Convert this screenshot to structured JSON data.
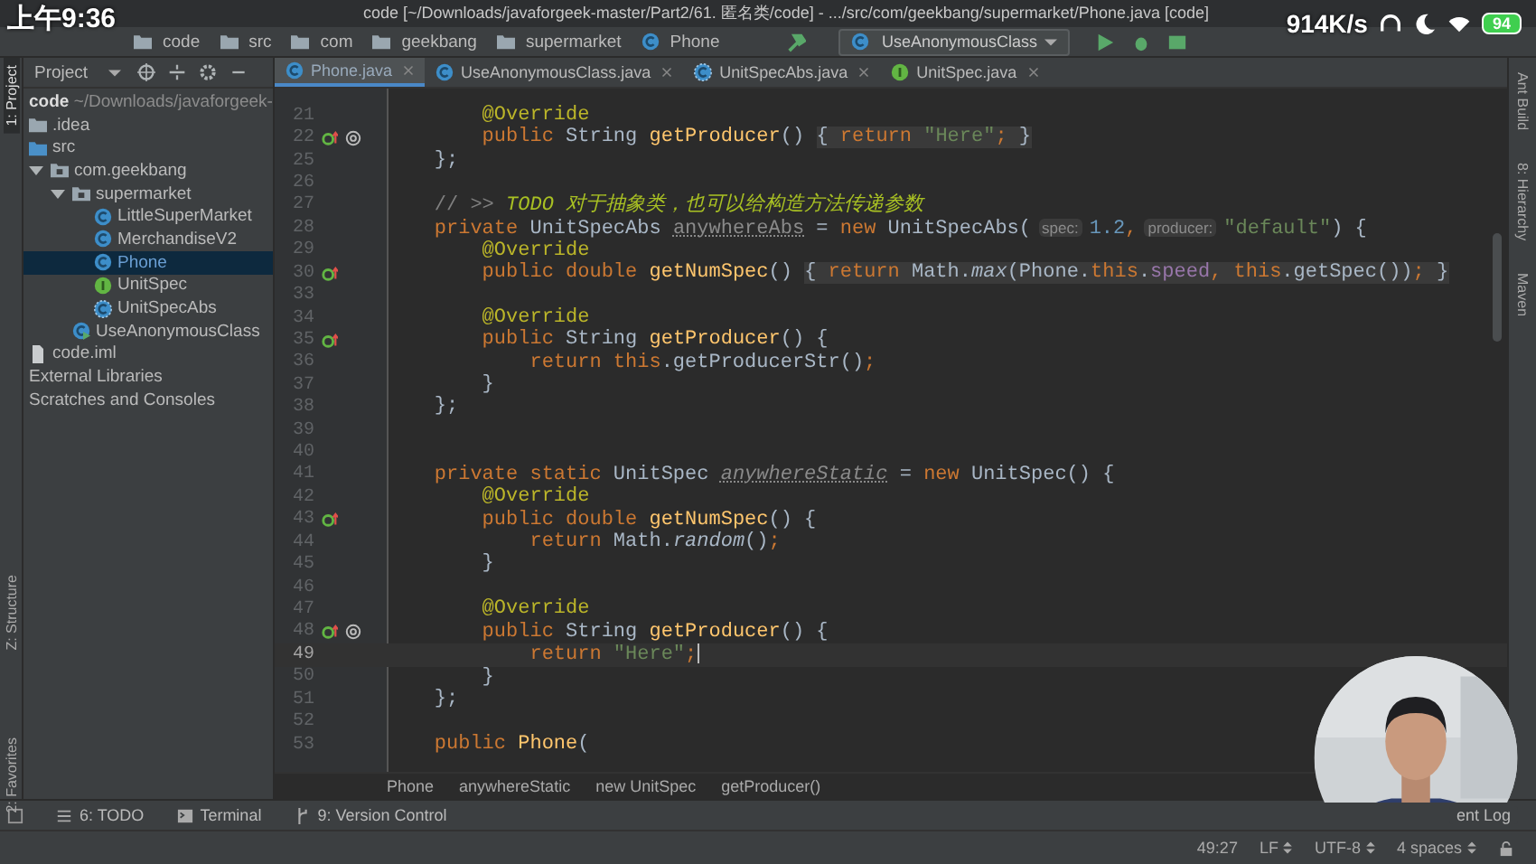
{
  "overlay": {
    "time": "上午9:36",
    "speed": "914K/s",
    "battery": "94"
  },
  "window": {
    "title": "code [~/Downloads/javaforgeek-master/Part2/61. 匿名类/code] - .../src/com/geekbang/supermarket/Phone.java [code]"
  },
  "nav_bar": {
    "crumbs": [
      {
        "label": "code",
        "kind": "folder"
      },
      {
        "label": "src",
        "kind": "folder"
      },
      {
        "label": "com",
        "kind": "folder"
      },
      {
        "label": "geekbang",
        "kind": "folder"
      },
      {
        "label": "supermarket",
        "kind": "folder"
      },
      {
        "label": "Phone",
        "kind": "class"
      }
    ],
    "run_config": "UseAnonymousClass"
  },
  "left_strip": [
    {
      "label": "1: Project",
      "selected": true
    },
    {
      "label": "Z: Structure",
      "selected": false
    },
    {
      "label": "2: Favorites",
      "selected": false
    }
  ],
  "right_strip": [
    {
      "label": "Ant Build"
    },
    {
      "label": "8: Hierarchy"
    },
    {
      "label": "Maven"
    }
  ],
  "project_panel": {
    "title": "Project",
    "root": {
      "label": "code",
      "path": "~/Downloads/javaforgeek-"
    },
    "tree": [
      {
        "label": ".idea",
        "kind": "folder",
        "selected": false
      },
      {
        "label": "src",
        "kind": "source_folder",
        "selected": false
      },
      {
        "label": "com.geekbang",
        "kind": "package",
        "selected": false,
        "expanded": true,
        "children": [
          {
            "label": "supermarket",
            "kind": "package",
            "selected": false,
            "expanded": true,
            "children": [
              {
                "label": "LittleSuperMarket",
                "kind": "class",
                "selected": false
              },
              {
                "label": "MerchandiseV2",
                "kind": "class",
                "selected": false
              },
              {
                "label": "Phone",
                "kind": "class",
                "selected": true
              },
              {
                "label": "UnitSpec",
                "kind": "interface",
                "selected": false
              },
              {
                "label": "UnitSpecAbs",
                "kind": "abstract_class",
                "selected": false
              }
            ]
          },
          {
            "label": "UseAnonymousClass",
            "kind": "runnable_class",
            "selected": false
          }
        ]
      },
      {
        "label": "code.iml",
        "kind": "file",
        "selected": false
      },
      {
        "label": "External Libraries",
        "kind": "plain",
        "selected": false
      },
      {
        "label": "Scratches and Consoles",
        "kind": "plain",
        "selected": false
      }
    ]
  },
  "tabs": [
    {
      "label": "Phone.java",
      "kind": "class",
      "selected": true
    },
    {
      "label": "UseAnonymousClass.java",
      "kind": "class",
      "selected": false
    },
    {
      "label": "UnitSpecAbs.java",
      "kind": "abstract_class",
      "selected": false
    },
    {
      "label": "UnitSpec.java",
      "kind": "interface",
      "selected": false
    }
  ],
  "lines": [
    {
      "number": "21",
      "current": false,
      "tokens": [
        {
          "kind": "annotation",
          "text": "        @Override"
        }
      ]
    },
    {
      "number": "22",
      "current": false,
      "gutter": [
        {
          "kind": "override"
        },
        {
          "kind": "at"
        }
      ],
      "tokens": [
        {
          "kind": "keyword",
          "text": "        public "
        },
        {
          "kind": "plain",
          "text": "String "
        },
        {
          "kind": "method",
          "text": "getProducer"
        },
        {
          "kind": "plain",
          "text": "() "
        }
      ],
      "folded": [
        {
          "kind": "plain",
          "text": "{ "
        },
        {
          "kind": "keyword",
          "text": "return "
        },
        {
          "kind": "string",
          "text": "\"Here\""
        },
        {
          "kind": "keyword",
          "text": ";"
        },
        {
          "kind": "plain",
          "text": " }"
        }
      ]
    },
    {
      "number": "25",
      "current": false,
      "tokens": [
        {
          "kind": "plain",
          "text": "    };"
        }
      ]
    },
    {
      "number": "26",
      "current": false
    },
    {
      "number": "27",
      "current": false,
      "tokens": [
        {
          "kind": "comment",
          "text": "    // >> "
        },
        {
          "kind": "todo",
          "text": "TODO 对于抽象类，也可以给构造方法传递参数"
        }
      ]
    },
    {
      "number": "28",
      "current": false,
      "tokens": [
        {
          "kind": "keyword",
          "text": "    private "
        },
        {
          "kind": "plain",
          "text": "UnitSpecAbs "
        },
        {
          "kind": "unused",
          "text": "anywhereAbs"
        },
        {
          "kind": "plain",
          "text": " = "
        },
        {
          "kind": "keyword",
          "text": "new "
        },
        {
          "kind": "plain",
          "text": "UnitSpecAbs("
        },
        {
          "kind": "hint",
          "text": "spec:"
        },
        {
          "kind": "number",
          "text": "1.2"
        },
        {
          "kind": "keyword",
          "text": ","
        },
        {
          "kind": "hint",
          "text": "producer:"
        },
        {
          "kind": "string",
          "text": "\"default\""
        },
        {
          "kind": "plain",
          "text": ") {"
        }
      ]
    },
    {
      "number": "29",
      "current": false,
      "tokens": [
        {
          "kind": "annotation",
          "text": "        @Override"
        }
      ]
    },
    {
      "number": "30",
      "current": false,
      "gutter": [
        {
          "kind": "override"
        }
      ],
      "tokens": [
        {
          "kind": "keyword",
          "text": "        public double "
        },
        {
          "kind": "method",
          "text": "getNumSpec"
        },
        {
          "kind": "plain",
          "text": "() "
        }
      ],
      "folded": [
        {
          "kind": "plain",
          "text": "{ "
        },
        {
          "kind": "keyword",
          "text": "return "
        },
        {
          "kind": "plain",
          "text": "Math."
        },
        {
          "kind": "static_call",
          "text": "max"
        },
        {
          "kind": "plain",
          "text": "(Phone."
        },
        {
          "kind": "keyword",
          "text": "this"
        },
        {
          "kind": "plain",
          "text": "."
        },
        {
          "kind": "field",
          "text": "speed"
        },
        {
          "kind": "keyword",
          "text": ", this"
        },
        {
          "kind": "plain",
          "text": ".getSpec())"
        },
        {
          "kind": "keyword",
          "text": ";"
        },
        {
          "kind": "plain",
          "text": " }"
        }
      ]
    },
    {
      "number": "33",
      "current": false
    },
    {
      "number": "34",
      "current": false,
      "tokens": [
        {
          "kind": "annotation",
          "text": "        @Override"
        }
      ]
    },
    {
      "number": "35",
      "current": false,
      "gutter": [
        {
          "kind": "override"
        }
      ],
      "tokens": [
        {
          "kind": "keyword",
          "text": "        public "
        },
        {
          "kind": "plain",
          "text": "String "
        },
        {
          "kind": "method",
          "text": "getProducer"
        },
        {
          "kind": "plain",
          "text": "() {"
        }
      ]
    },
    {
      "number": "36",
      "current": false,
      "tokens": [
        {
          "kind": "keyword",
          "text": "            return this"
        },
        {
          "kind": "plain",
          "text": ".getProducerStr()"
        },
        {
          "kind": "keyword",
          "text": ";"
        }
      ]
    },
    {
      "number": "37",
      "current": false,
      "tokens": [
        {
          "kind": "plain",
          "text": "        }"
        }
      ]
    },
    {
      "number": "38",
      "current": false,
      "tokens": [
        {
          "kind": "plain",
          "text": "    };"
        }
      ]
    },
    {
      "number": "39",
      "current": false
    },
    {
      "number": "40",
      "current": false
    },
    {
      "number": "41",
      "current": false,
      "tokens": [
        {
          "kind": "keyword",
          "text": "    private static "
        },
        {
          "kind": "plain",
          "text": "UnitSpec "
        },
        {
          "kind": "unused_static",
          "text": "anywhereStatic"
        },
        {
          "kind": "plain",
          "text": " = "
        },
        {
          "kind": "keyword",
          "text": "new "
        },
        {
          "kind": "plain",
          "text": "UnitSpec() {"
        }
      ]
    },
    {
      "number": "42",
      "current": false,
      "tokens": [
        {
          "kind": "annotation",
          "text": "        @Override"
        }
      ]
    },
    {
      "number": "43",
      "current": false,
      "gutter": [
        {
          "kind": "override"
        }
      ],
      "tokens": [
        {
          "kind": "keyword",
          "text": "        public double "
        },
        {
          "kind": "method",
          "text": "getNumSpec"
        },
        {
          "kind": "plain",
          "text": "() {"
        }
      ]
    },
    {
      "number": "44",
      "current": false,
      "tokens": [
        {
          "kind": "keyword",
          "text": "            return "
        },
        {
          "kind": "plain",
          "text": "Math."
        },
        {
          "kind": "static_call",
          "text": "random"
        },
        {
          "kind": "plain",
          "text": "()"
        },
        {
          "kind": "keyword",
          "text": ";"
        }
      ]
    },
    {
      "number": "45",
      "current": false,
      "tokens": [
        {
          "kind": "plain",
          "text": "        }"
        }
      ]
    },
    {
      "number": "46",
      "current": false
    },
    {
      "number": "47",
      "current": false,
      "tokens": [
        {
          "kind": "annotation",
          "text": "        @Override"
        }
      ]
    },
    {
      "number": "48",
      "current": false,
      "gutter": [
        {
          "kind": "override"
        },
        {
          "kind": "at"
        }
      ],
      "tokens": [
        {
          "kind": "keyword",
          "text": "        public "
        },
        {
          "kind": "plain",
          "text": "String "
        },
        {
          "kind": "method",
          "text": "getProducer"
        },
        {
          "kind": "plain",
          "text": "() {"
        }
      ]
    },
    {
      "number": "49",
      "current": true,
      "tokens": [
        {
          "kind": "keyword",
          "text": "            return "
        },
        {
          "kind": "string",
          "text": "\"Here\""
        },
        {
          "kind": "keyword",
          "text": ";"
        }
      ]
    },
    {
      "number": "50",
      "current": false,
      "tokens": [
        {
          "kind": "plain",
          "text": "        }"
        }
      ]
    },
    {
      "number": "51",
      "current": false,
      "tokens": [
        {
          "kind": "plain",
          "text": "    };"
        }
      ]
    },
    {
      "number": "52",
      "current": false
    },
    {
      "number": "53",
      "current": false,
      "tokens": [
        {
          "kind": "keyword",
          "text": "    public "
        },
        {
          "kind": "method",
          "text": "Phone"
        },
        {
          "kind": "plain",
          "text": "("
        }
      ]
    }
  ],
  "breadcrumbs": [
    "Phone",
    "anywhereStatic",
    "new UnitSpec",
    "getProducer()"
  ],
  "tool_buttons": [
    {
      "label": "6: TODO",
      "kind": "todo"
    },
    {
      "label": "Terminal",
      "kind": "terminal"
    },
    {
      "label": "9: Version Control",
      "kind": "vcs"
    }
  ],
  "event_log": "ent Log",
  "status_bar": {
    "position": "49:27",
    "line_separator": "LF",
    "encoding": "UTF-8",
    "indent": "4 spaces"
  },
  "webcam": {
    "kind": "picture"
  }
}
